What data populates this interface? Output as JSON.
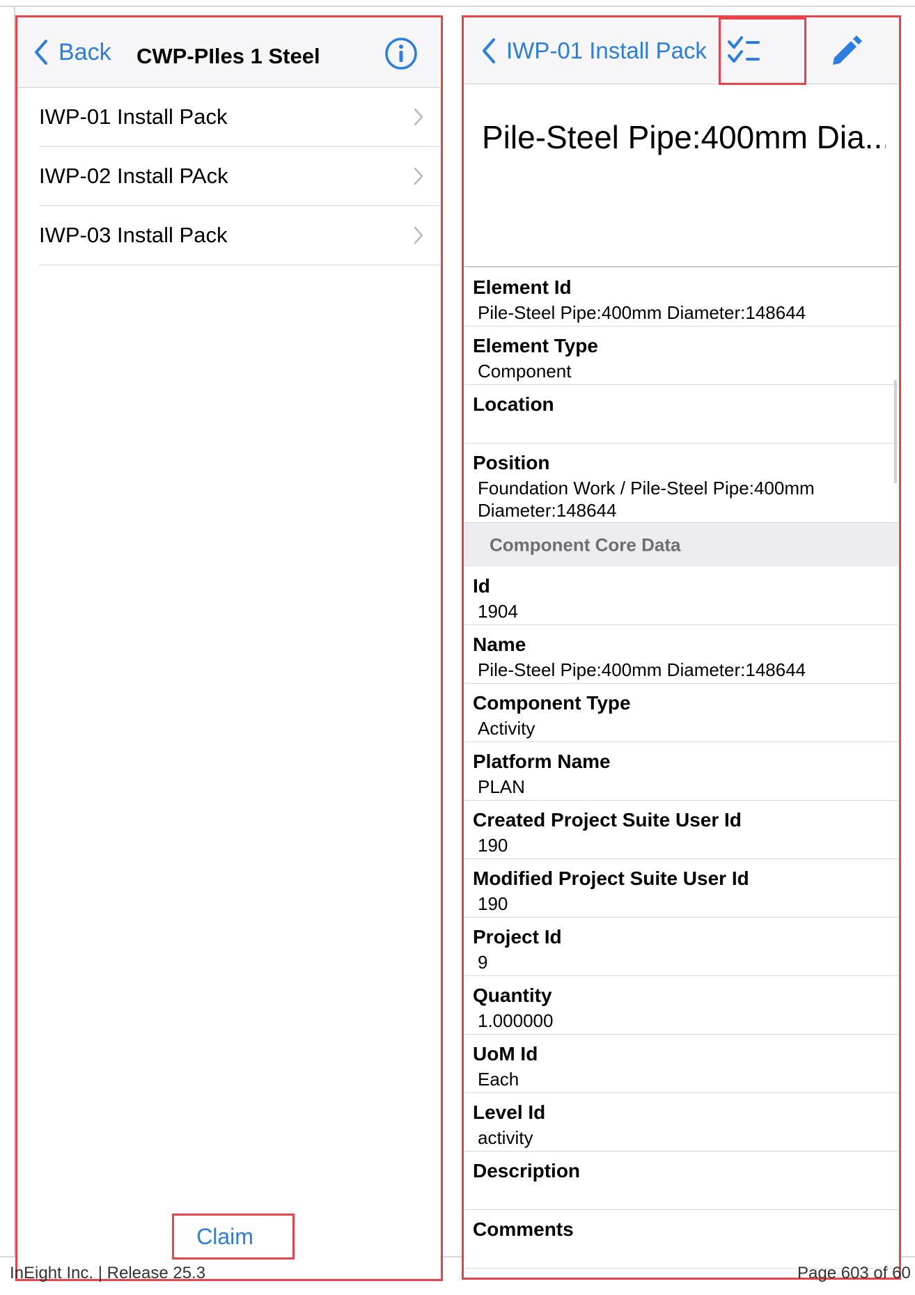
{
  "left": {
    "back_label": "Back",
    "title": "CWP-PIles 1 Steel",
    "items": [
      {
        "label": "IWP-01 Install Pack"
      },
      {
        "label": "IWP-02 Install PAck"
      },
      {
        "label": "IWP-03 Install Pack"
      }
    ],
    "claim_label": "Claim"
  },
  "right": {
    "back_label": "IWP-01 Install Pack",
    "element_title": "Pile-Steel Pipe:400mm Dia...",
    "properties_top": [
      {
        "label": "Element Id",
        "value": "Pile-Steel Pipe:400mm Diameter:148644"
      },
      {
        "label": "Element Type",
        "value": "Component"
      },
      {
        "label": "Location",
        "value": ""
      },
      {
        "label": "Position",
        "value": "Foundation Work / Pile-Steel Pipe:400mm Diameter:148644"
      }
    ],
    "section_label": "Component Core Data",
    "properties_core": [
      {
        "label": "Id",
        "value": "1904"
      },
      {
        "label": "Name",
        "value": "Pile-Steel Pipe:400mm Diameter:148644"
      },
      {
        "label": "Component Type",
        "value": "Activity"
      },
      {
        "label": "Platform Name",
        "value": "PLAN"
      },
      {
        "label": "Created Project Suite User Id",
        "value": "190"
      },
      {
        "label": "Modified Project Suite User Id",
        "value": "190"
      },
      {
        "label": "Project Id",
        "value": "9"
      },
      {
        "label": "Quantity",
        "value": "1.000000"
      },
      {
        "label": "UoM Id",
        "value": "Each"
      },
      {
        "label": "Level Id",
        "value": "activity"
      },
      {
        "label": "Description",
        "value": ""
      },
      {
        "label": "Comments",
        "value": ""
      }
    ]
  },
  "footer": {
    "left_text": "InEight Inc.  |  Release 25.3",
    "right_text": "Page 603 of 60"
  },
  "colors": {
    "accent": "#2a7de1",
    "annotation": "#e9424a",
    "section_bg": "#ededf1"
  },
  "icons": {
    "back": "chevron-left-icon",
    "info": "info-circle-icon",
    "row": "chevron-right-icon",
    "checklist": "checklist-icon",
    "edit": "pencil-icon"
  }
}
